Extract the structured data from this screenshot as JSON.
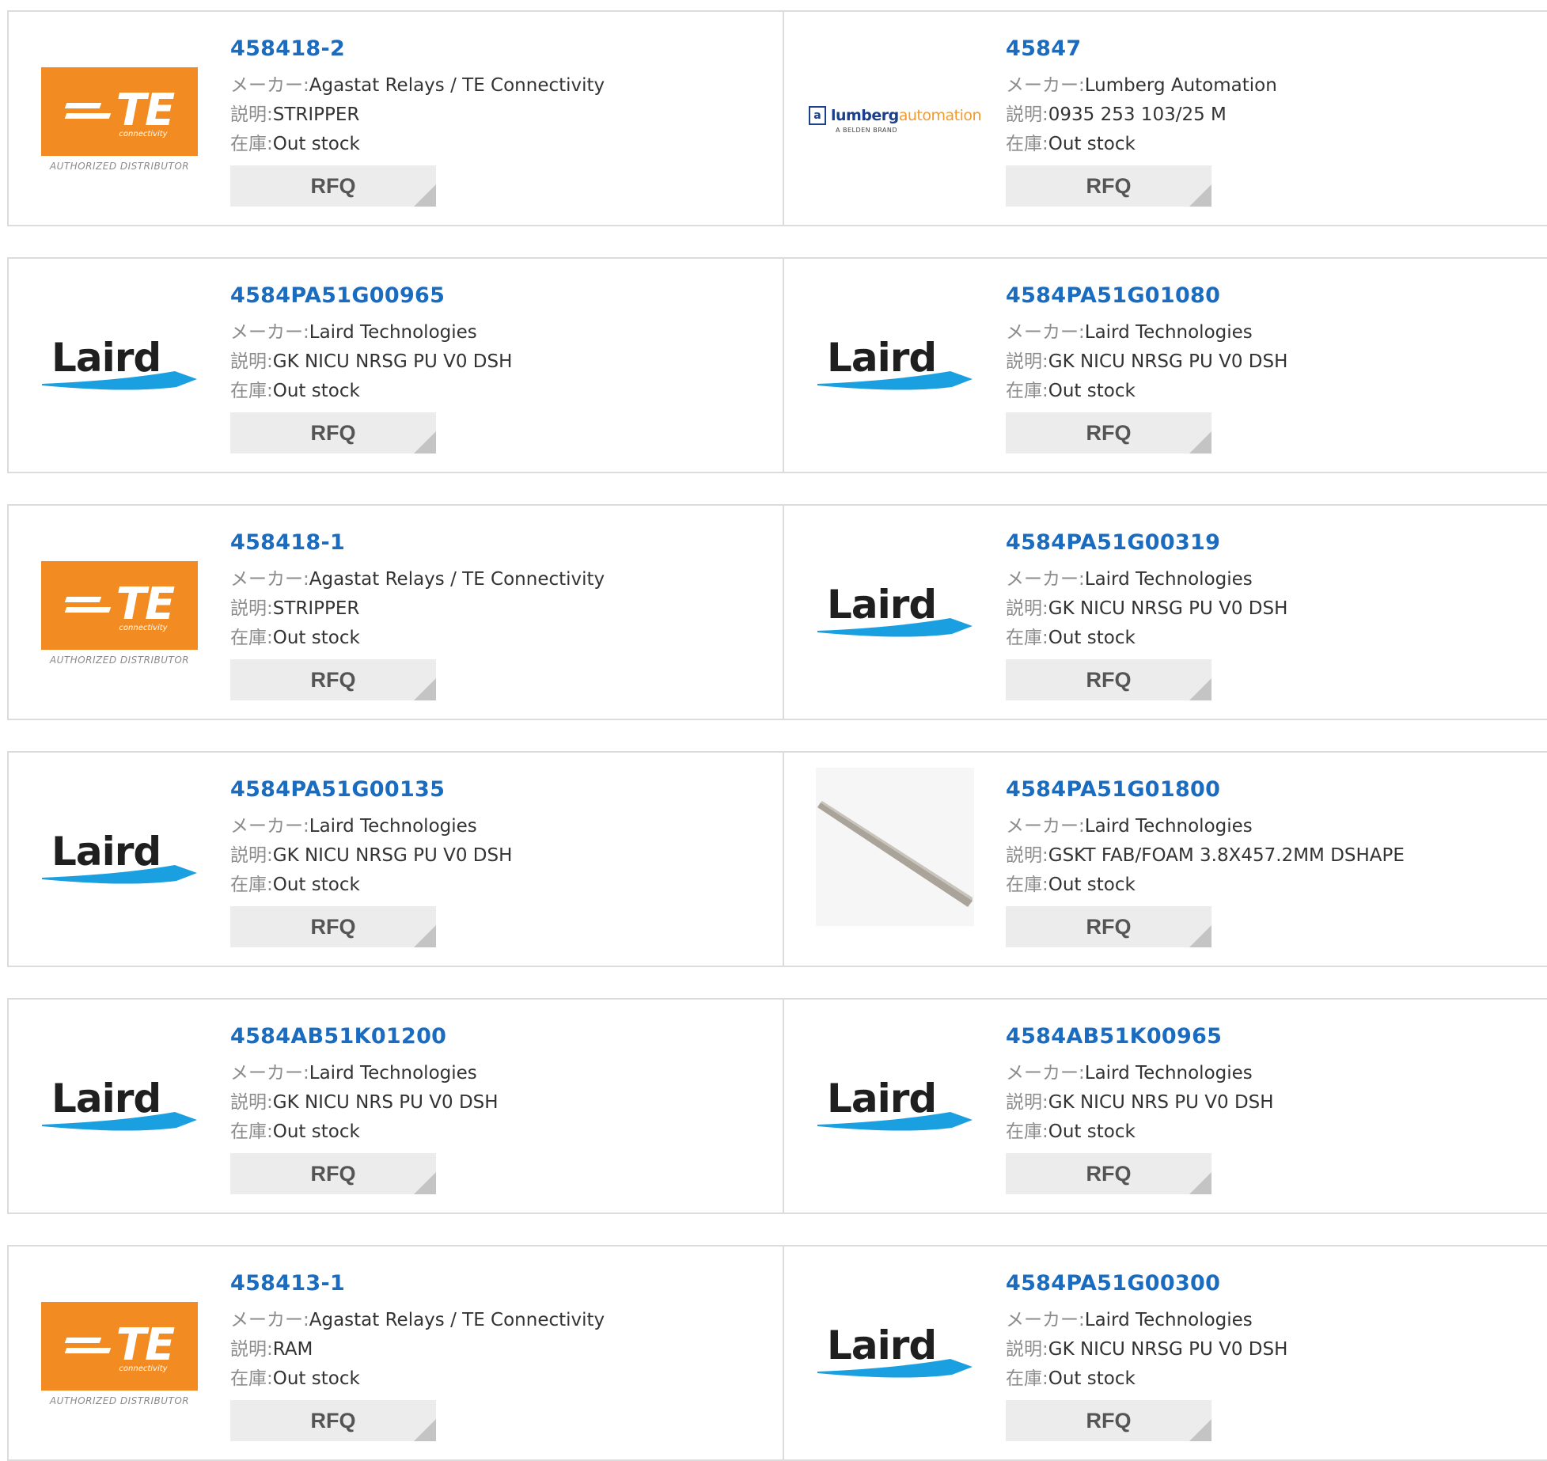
{
  "labels": {
    "maker": "メーカー:",
    "desc": "説明:",
    "stock": "在庫:",
    "rfq": "RFQ"
  },
  "logos": {
    "te": {
      "text": "TE",
      "sub": "connectivity",
      "tagline": "AUTHORIZED DISTRIBUTOR"
    },
    "laird": {
      "text": "Laird"
    },
    "lumberg": {
      "mark": "a",
      "name_a": "lumberg",
      "name_b": "automation",
      "sub": "A BELDEN BRAND"
    }
  },
  "colors": {
    "part_link": "#1a6cc0",
    "te_orange": "#f28c22",
    "laird_blue": "#1aa0e0",
    "lumberg_blue": "#1c3f8c",
    "lumberg_orange": "#f29a2e"
  },
  "products": [
    [
      {
        "part": "458418-2",
        "logo": "te",
        "maker": "Agastat Relays / TE Connectivity",
        "desc": "STRIPPER",
        "stock": "Out stock"
      },
      {
        "part": "45847",
        "logo": "lumberg",
        "maker": "Lumberg Automation",
        "desc": "0935 253 103/25 M",
        "stock": "Out stock"
      }
    ],
    [
      {
        "part": "4584PA51G00965",
        "logo": "laird",
        "maker": "Laird Technologies",
        "desc": "GK NICU NRSG PU V0 DSH",
        "stock": "Out stock"
      },
      {
        "part": "4584PA51G01080",
        "logo": "laird",
        "maker": "Laird Technologies",
        "desc": "GK NICU NRSG PU V0 DSH",
        "stock": "Out stock"
      }
    ],
    [
      {
        "part": "458418-1",
        "logo": "te",
        "maker": "Agastat Relays / TE Connectivity",
        "desc": "STRIPPER",
        "stock": "Out stock"
      },
      {
        "part": "4584PA51G00319",
        "logo": "laird",
        "maker": "Laird Technologies",
        "desc": "GK NICU NRSG PU V0 DSH",
        "stock": "Out stock"
      }
    ],
    [
      {
        "part": "4584PA51G00135",
        "logo": "laird",
        "maker": "Laird Technologies",
        "desc": "GK NICU NRSG PU V0 DSH",
        "stock": "Out stock"
      },
      {
        "part": "4584PA51G01800",
        "logo": "photo",
        "maker": "Laird Technologies",
        "desc": "GSKT FAB/FOAM 3.8X457.2MM DSHAPE",
        "stock": "Out stock"
      }
    ],
    [
      {
        "part": "4584AB51K01200",
        "logo": "laird",
        "maker": "Laird Technologies",
        "desc": "GK NICU NRS PU V0 DSH",
        "stock": "Out stock"
      },
      {
        "part": "4584AB51K00965",
        "logo": "laird",
        "maker": "Laird Technologies",
        "desc": "GK NICU NRS PU V0 DSH",
        "stock": "Out stock"
      }
    ],
    [
      {
        "part": "458413-1",
        "logo": "te",
        "maker": "Agastat Relays / TE Connectivity",
        "desc": "RAM",
        "stock": "Out stock"
      },
      {
        "part": "4584PA51G00300",
        "logo": "laird",
        "maker": "Laird Technologies",
        "desc": "GK NICU NRSG PU V0 DSH",
        "stock": "Out stock"
      }
    ]
  ]
}
